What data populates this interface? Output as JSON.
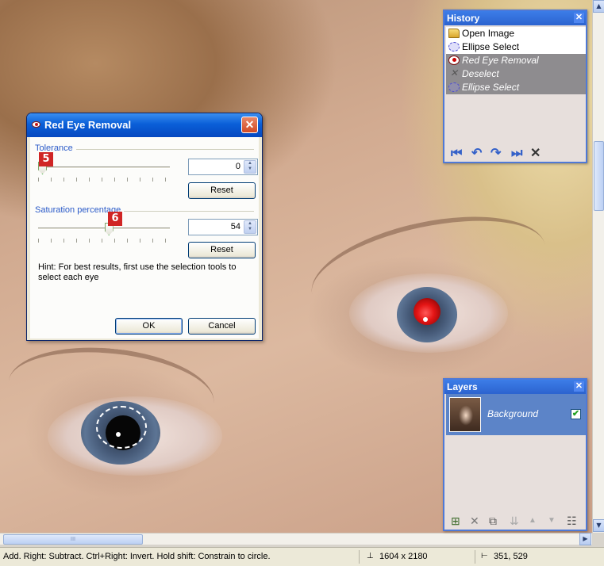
{
  "dialog": {
    "title": "Red Eye Removal",
    "close_glyph": "✕",
    "tolerance": {
      "label": "Tolerance",
      "value": "0",
      "value_fraction": 0.0,
      "reset_label": "Reset"
    },
    "saturation": {
      "label": "Saturation percentage",
      "value": "54",
      "value_fraction": 0.54,
      "reset_label": "Reset"
    },
    "hint": "Hint: For best results, first use the selection tools to select each eye",
    "ok_label": "OK",
    "cancel_label": "Cancel"
  },
  "badges": {
    "tolerance": "5",
    "saturation": "6"
  },
  "history": {
    "title": "History",
    "close_glyph": "✕",
    "items": [
      {
        "label": "Open Image",
        "icon": "folder-icon",
        "state": "done"
      },
      {
        "label": "Ellipse Select",
        "icon": "ellipse-select-icon",
        "state": "done"
      },
      {
        "label": "Red Eye Removal",
        "icon": "red-eye-icon",
        "state": "undone"
      },
      {
        "label": "Deselect",
        "icon": "deselect-icon",
        "state": "undone"
      },
      {
        "label": "Ellipse Select",
        "icon": "ellipse-select-icon",
        "state": "undone"
      }
    ],
    "toolbar": {
      "first": "⏮",
      "undo": "↶",
      "redo": "↷",
      "last": "⏭",
      "clear": "✕"
    }
  },
  "layers": {
    "title": "Layers",
    "close_glyph": "✕",
    "items": [
      {
        "name": "Background",
        "visible": true,
        "check_glyph": "✔"
      }
    ],
    "toolbar": {
      "add": "⊞",
      "delete": "✕",
      "duplicate": "⧉",
      "merge": "⇊",
      "up": "▲",
      "down": "▼",
      "properties": "☷"
    }
  },
  "status": {
    "hint": "Add. Right: Subtract. Ctrl+Right: Invert. Hold shift: Constrain to circle.",
    "image_size": "1604 x 2180",
    "cursor_position": "351, 529"
  },
  "scrollbars": {
    "up_arrow": "▲",
    "down_arrow": "▼",
    "right_arrow": "▶",
    "hthumb_grip": "III"
  },
  "colors": {
    "titlebar": "#0a5fd8",
    "tool_border": "#4f79d6",
    "badge": "#d02525",
    "group_label": "#2a5ac8"
  }
}
